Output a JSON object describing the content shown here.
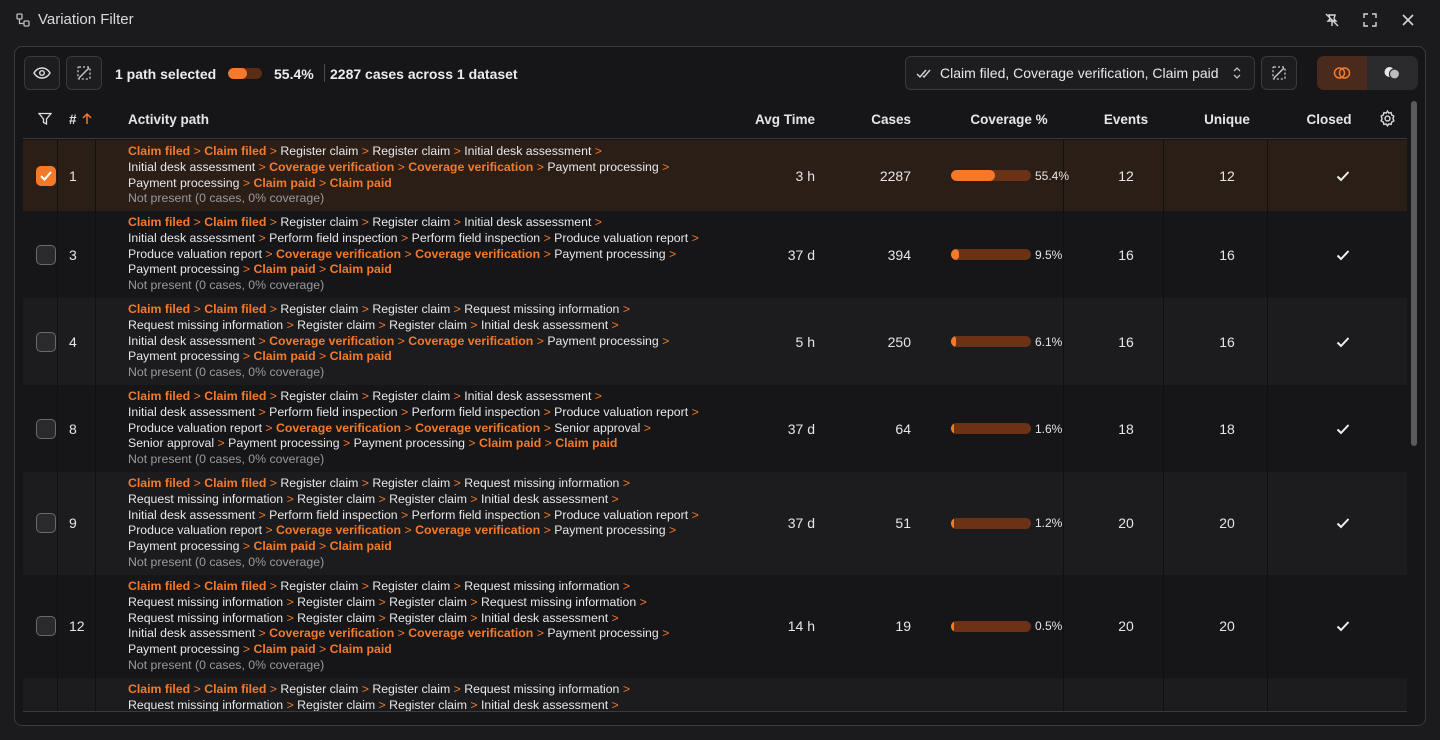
{
  "window": {
    "title": "Variation Filter",
    "icon": "filter-nodes-icon",
    "buttons": [
      "pin-off-icon",
      "expand-icon",
      "close-icon"
    ]
  },
  "toolbar": {
    "view_icon": "eye-icon",
    "clear_icon": "clear-selection-icon",
    "selected_text": "1 path selected",
    "selected_fraction": 0.554,
    "percent_text": "55.4%",
    "cases_text": "2287 cases across 1 dataset",
    "path_filter_value": "Claim filed, Coverage verification, Claim paid",
    "path_filter_icon": "double-check-icon",
    "clear_filter_icon": "clear-selection-icon",
    "mode_buttons": [
      "overlap-icon",
      "merge-icon"
    ],
    "active_mode": 0
  },
  "columns": {
    "filter_icon": "filter-icon",
    "num": "#",
    "sort_icon": "arrow-up-icon",
    "activity": "Activity path",
    "avg_time": "Avg Time",
    "cases": "Cases",
    "coverage": "Coverage %",
    "events": "Events",
    "unique": "Unique",
    "closed": "Closed",
    "settings_icon": "gear-icon"
  },
  "colors": {
    "accent": "#f47a2a",
    "bar_track": "#6b3216",
    "selected_row": "#2b1e17"
  },
  "rows": [
    {
      "num": "1",
      "checked": true,
      "avg_time": "3 h",
      "cases": "2287",
      "coverage": 0.554,
      "coverage_text": "55.4%",
      "events": "12",
      "unique": "12",
      "closed": true,
      "lines": [
        [
          [
            "Claim filed",
            1
          ],
          [
            " > ",
            2
          ],
          [
            "Claim filed",
            1
          ],
          [
            " > ",
            2
          ],
          [
            "Register claim",
            0
          ],
          [
            " > ",
            2
          ],
          [
            "Register claim",
            0
          ],
          [
            " > ",
            2
          ],
          [
            "Initial desk assessment",
            0
          ],
          [
            " >",
            2
          ]
        ],
        [
          [
            "Initial desk assessment",
            0
          ],
          [
            " > ",
            2
          ],
          [
            "Coverage verification",
            1
          ],
          [
            " > ",
            2
          ],
          [
            "Coverage verification",
            1
          ],
          [
            " > ",
            2
          ],
          [
            "Payment processing",
            0
          ],
          [
            " >",
            2
          ]
        ],
        [
          [
            "Payment processing",
            0
          ],
          [
            " > ",
            2
          ],
          [
            "Claim paid",
            1
          ],
          [
            " > ",
            2
          ],
          [
            "Claim paid",
            1
          ]
        ],
        [
          [
            "Not present (0 cases, 0% coverage)",
            3
          ]
        ]
      ]
    },
    {
      "num": "3",
      "checked": false,
      "avg_time": "37 d",
      "cases": "394",
      "coverage": 0.095,
      "coverage_text": "9.5%",
      "events": "16",
      "unique": "16",
      "closed": true,
      "lines": [
        [
          [
            "Claim filed",
            1
          ],
          [
            " > ",
            2
          ],
          [
            "Claim filed",
            1
          ],
          [
            " > ",
            2
          ],
          [
            "Register claim",
            0
          ],
          [
            " > ",
            2
          ],
          [
            "Register claim",
            0
          ],
          [
            " > ",
            2
          ],
          [
            "Initial desk assessment",
            0
          ],
          [
            " >",
            2
          ]
        ],
        [
          [
            "Initial desk assessment",
            0
          ],
          [
            " > ",
            2
          ],
          [
            "Perform field inspection",
            0
          ],
          [
            " > ",
            2
          ],
          [
            "Perform field inspection",
            0
          ],
          [
            " > ",
            2
          ],
          [
            "Produce valuation report",
            0
          ],
          [
            " >",
            2
          ]
        ],
        [
          [
            "Produce valuation report",
            0
          ],
          [
            " > ",
            2
          ],
          [
            "Coverage verification",
            1
          ],
          [
            " > ",
            2
          ],
          [
            "Coverage verification",
            1
          ],
          [
            " > ",
            2
          ],
          [
            "Payment processing",
            0
          ],
          [
            " >",
            2
          ]
        ],
        [
          [
            "Payment processing",
            0
          ],
          [
            " > ",
            2
          ],
          [
            "Claim paid",
            1
          ],
          [
            " > ",
            2
          ],
          [
            "Claim paid",
            1
          ]
        ],
        [
          [
            "Not present (0 cases, 0% coverage)",
            3
          ]
        ]
      ]
    },
    {
      "num": "4",
      "checked": false,
      "avg_time": "5 h",
      "cases": "250",
      "coverage": 0.061,
      "coverage_text": "6.1%",
      "events": "16",
      "unique": "16",
      "closed": true,
      "lines": [
        [
          [
            "Claim filed",
            1
          ],
          [
            " > ",
            2
          ],
          [
            "Claim filed",
            1
          ],
          [
            " > ",
            2
          ],
          [
            "Register claim",
            0
          ],
          [
            " > ",
            2
          ],
          [
            "Register claim",
            0
          ],
          [
            " > ",
            2
          ],
          [
            "Request missing information",
            0
          ],
          [
            " >",
            2
          ]
        ],
        [
          [
            "Request missing information",
            0
          ],
          [
            " > ",
            2
          ],
          [
            "Register claim",
            0
          ],
          [
            " > ",
            2
          ],
          [
            "Register claim",
            0
          ],
          [
            " > ",
            2
          ],
          [
            "Initial desk assessment",
            0
          ],
          [
            " >",
            2
          ]
        ],
        [
          [
            "Initial desk assessment",
            0
          ],
          [
            " > ",
            2
          ],
          [
            "Coverage verification",
            1
          ],
          [
            " > ",
            2
          ],
          [
            "Coverage verification",
            1
          ],
          [
            " > ",
            2
          ],
          [
            "Payment processing",
            0
          ],
          [
            " >",
            2
          ]
        ],
        [
          [
            "Payment processing",
            0
          ],
          [
            " > ",
            2
          ],
          [
            "Claim paid",
            1
          ],
          [
            " > ",
            2
          ],
          [
            "Claim paid",
            1
          ]
        ],
        [
          [
            "Not present (0 cases, 0% coverage)",
            3
          ]
        ]
      ]
    },
    {
      "num": "8",
      "checked": false,
      "avg_time": "37 d",
      "cases": "64",
      "coverage": 0.016,
      "coverage_text": "1.6%",
      "events": "18",
      "unique": "18",
      "closed": true,
      "lines": [
        [
          [
            "Claim filed",
            1
          ],
          [
            " > ",
            2
          ],
          [
            "Claim filed",
            1
          ],
          [
            " > ",
            2
          ],
          [
            "Register claim",
            0
          ],
          [
            " > ",
            2
          ],
          [
            "Register claim",
            0
          ],
          [
            " > ",
            2
          ],
          [
            "Initial desk assessment",
            0
          ],
          [
            " >",
            2
          ]
        ],
        [
          [
            "Initial desk assessment",
            0
          ],
          [
            " > ",
            2
          ],
          [
            "Perform field inspection",
            0
          ],
          [
            " > ",
            2
          ],
          [
            "Perform field inspection",
            0
          ],
          [
            " > ",
            2
          ],
          [
            "Produce valuation report",
            0
          ],
          [
            " >",
            2
          ]
        ],
        [
          [
            "Produce valuation report",
            0
          ],
          [
            " > ",
            2
          ],
          [
            "Coverage verification",
            1
          ],
          [
            " > ",
            2
          ],
          [
            "Coverage verification",
            1
          ],
          [
            " > ",
            2
          ],
          [
            "Senior approval",
            0
          ],
          [
            " >",
            2
          ]
        ],
        [
          [
            "Senior approval",
            0
          ],
          [
            " > ",
            2
          ],
          [
            "Payment processing",
            0
          ],
          [
            " > ",
            2
          ],
          [
            "Payment processing",
            0
          ],
          [
            " > ",
            2
          ],
          [
            "Claim paid",
            1
          ],
          [
            " > ",
            2
          ],
          [
            "Claim paid",
            1
          ]
        ],
        [
          [
            "Not present (0 cases, 0% coverage)",
            3
          ]
        ]
      ]
    },
    {
      "num": "9",
      "checked": false,
      "avg_time": "37 d",
      "cases": "51",
      "coverage": 0.012,
      "coverage_text": "1.2%",
      "events": "20",
      "unique": "20",
      "closed": true,
      "lines": [
        [
          [
            "Claim filed",
            1
          ],
          [
            " > ",
            2
          ],
          [
            "Claim filed",
            1
          ],
          [
            " > ",
            2
          ],
          [
            "Register claim",
            0
          ],
          [
            " > ",
            2
          ],
          [
            "Register claim",
            0
          ],
          [
            " > ",
            2
          ],
          [
            "Request missing information",
            0
          ],
          [
            " >",
            2
          ]
        ],
        [
          [
            "Request missing information",
            0
          ],
          [
            " > ",
            2
          ],
          [
            "Register claim",
            0
          ],
          [
            " > ",
            2
          ],
          [
            "Register claim",
            0
          ],
          [
            " > ",
            2
          ],
          [
            "Initial desk assessment",
            0
          ],
          [
            " >",
            2
          ]
        ],
        [
          [
            "Initial desk assessment",
            0
          ],
          [
            " > ",
            2
          ],
          [
            "Perform field inspection",
            0
          ],
          [
            " > ",
            2
          ],
          [
            "Perform field inspection",
            0
          ],
          [
            " > ",
            2
          ],
          [
            "Produce valuation report",
            0
          ],
          [
            " >",
            2
          ]
        ],
        [
          [
            "Produce valuation report",
            0
          ],
          [
            " > ",
            2
          ],
          [
            "Coverage verification",
            1
          ],
          [
            " > ",
            2
          ],
          [
            "Coverage verification",
            1
          ],
          [
            " > ",
            2
          ],
          [
            "Payment processing",
            0
          ],
          [
            " >",
            2
          ]
        ],
        [
          [
            "Payment processing",
            0
          ],
          [
            " > ",
            2
          ],
          [
            "Claim paid",
            1
          ],
          [
            " > ",
            2
          ],
          [
            "Claim paid",
            1
          ]
        ],
        [
          [
            "Not present (0 cases, 0% coverage)",
            3
          ]
        ]
      ]
    },
    {
      "num": "12",
      "checked": false,
      "avg_time": "14 h",
      "cases": "19",
      "coverage": 0.005,
      "coverage_text": "0.5%",
      "events": "20",
      "unique": "20",
      "closed": true,
      "lines": [
        [
          [
            "Claim filed",
            1
          ],
          [
            " > ",
            2
          ],
          [
            "Claim filed",
            1
          ],
          [
            " > ",
            2
          ],
          [
            "Register claim",
            0
          ],
          [
            " > ",
            2
          ],
          [
            "Register claim",
            0
          ],
          [
            " > ",
            2
          ],
          [
            "Request missing information",
            0
          ],
          [
            " >",
            2
          ]
        ],
        [
          [
            "Request missing information",
            0
          ],
          [
            " > ",
            2
          ],
          [
            "Register claim",
            0
          ],
          [
            " > ",
            2
          ],
          [
            "Register claim",
            0
          ],
          [
            " > ",
            2
          ],
          [
            "Request missing information",
            0
          ],
          [
            " >",
            2
          ]
        ],
        [
          [
            "Request missing information",
            0
          ],
          [
            " > ",
            2
          ],
          [
            "Register claim",
            0
          ],
          [
            " > ",
            2
          ],
          [
            "Register claim",
            0
          ],
          [
            " > ",
            2
          ],
          [
            "Initial desk assessment",
            0
          ],
          [
            " >",
            2
          ]
        ],
        [
          [
            "Initial desk assessment",
            0
          ],
          [
            " > ",
            2
          ],
          [
            "Coverage verification",
            1
          ],
          [
            " > ",
            2
          ],
          [
            "Coverage verification",
            1
          ],
          [
            " > ",
            2
          ],
          [
            "Payment processing",
            0
          ],
          [
            " >",
            2
          ]
        ],
        [
          [
            "Payment processing",
            0
          ],
          [
            " > ",
            2
          ],
          [
            "Claim paid",
            1
          ],
          [
            " > ",
            2
          ],
          [
            "Claim paid",
            1
          ]
        ],
        [
          [
            "Not present (0 cases, 0% coverage)",
            3
          ]
        ]
      ]
    },
    {
      "num": "",
      "checked": false,
      "avg_time": "",
      "cases": "",
      "coverage": null,
      "coverage_text": "",
      "events": "",
      "unique": "",
      "closed": false,
      "partial": true,
      "lines": [
        [
          [
            "Claim filed",
            1
          ],
          [
            " > ",
            2
          ],
          [
            "Claim filed",
            1
          ],
          [
            " > ",
            2
          ],
          [
            "Register claim",
            0
          ],
          [
            " > ",
            2
          ],
          [
            "Register claim",
            0
          ],
          [
            " > ",
            2
          ],
          [
            "Request missing information",
            0
          ],
          [
            " >",
            2
          ]
        ],
        [
          [
            "Request missing information",
            0
          ],
          [
            " > ",
            2
          ],
          [
            "Register claim",
            0
          ],
          [
            " > ",
            2
          ],
          [
            "Register claim",
            0
          ],
          [
            " > ",
            2
          ],
          [
            "Initial desk assessment",
            0
          ],
          [
            " >",
            2
          ]
        ]
      ]
    }
  ]
}
